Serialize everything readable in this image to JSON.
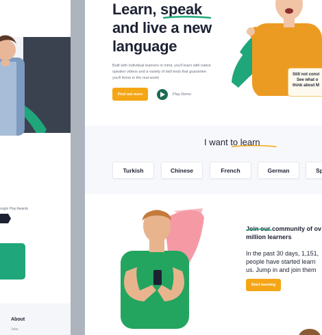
{
  "colors": {
    "accent": "#f4a616",
    "brand_green": "#1fa67a",
    "dark_green": "#1b6b54",
    "text_dark": "#1d2233",
    "text_muted": "#6b7080",
    "pink_brush": "#f59aa5"
  },
  "back_page": {
    "awards_text": "oogle Play Awards",
    "footer": {
      "about_label": "About",
      "jobs_label": "Jobs"
    }
  },
  "hero": {
    "title_line1": "Learn, speak",
    "title_line2": "and live a new",
    "title_line3": "language",
    "description": "Built with individual learners in mind, you'll learn with native speaker videos and a variety of skill tests that guarantee you'll thrive in the real world",
    "cta_label": "Find out more",
    "play_label": "Play Demo",
    "quote": [
      "Still not convi",
      "See what o",
      "think about M"
    ]
  },
  "learn_section": {
    "title": "I want to learn",
    "languages": [
      "Turkish",
      "Chinese",
      "French",
      "German",
      "Sp"
    ]
  },
  "community": {
    "title_line1": "Join our community of ov",
    "title_line2": "million learners",
    "body_line1": "In the past 30 days, 1,151,",
    "body_line2": "people have started learn",
    "body_line3": "us. Jump in and join them",
    "cta_label": "Start learning"
  }
}
